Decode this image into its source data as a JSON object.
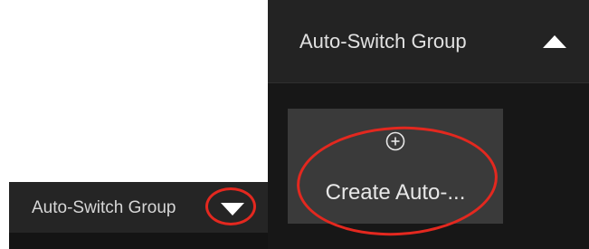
{
  "collapsed_panel": {
    "title": "Auto-Switch Group",
    "toggle_icon": "caret-down-icon"
  },
  "expanded_panel": {
    "title": "Auto-Switch Group",
    "toggle_icon": "caret-up-icon",
    "create_card": {
      "icon": "plus-circle-icon",
      "label": "Create Auto-..."
    }
  },
  "colors": {
    "header_bg": "#252525",
    "panel_bg": "#171717",
    "card_bg": "#3a3a3a",
    "text": "#e1e1e1",
    "highlight_annotation": "#e3281f"
  }
}
